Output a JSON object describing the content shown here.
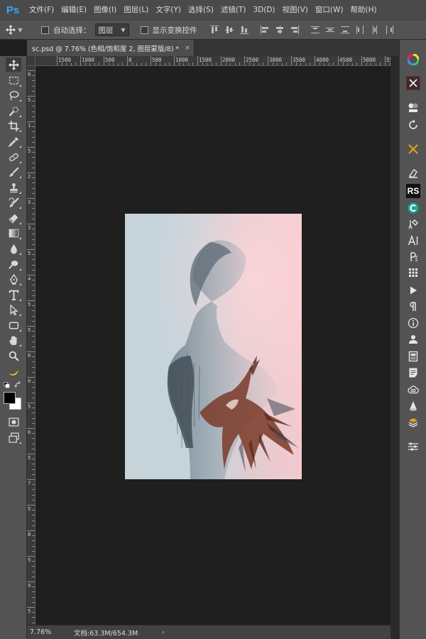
{
  "app": {
    "logo": "Ps"
  },
  "menubar": {
    "items": [
      "文件(F)",
      "编辑(E)",
      "图像(I)",
      "图层(L)",
      "文字(Y)",
      "选择(S)",
      "滤镜(T)",
      "3D(D)",
      "视图(V)",
      "窗口(W)",
      "帮助(H)"
    ]
  },
  "options": {
    "move_icon": "move-icon",
    "auto_select_label": "自动选择：",
    "auto_select_value": "图层",
    "show_transform_label": "显示变换控件"
  },
  "document": {
    "tab_title": "sc.psd @ 7.76% (色相/饱和度 2, 图层蒙版/8) *",
    "close_glyph": "×"
  },
  "rulers": {
    "top_labels": [
      "1500",
      "1000",
      "500",
      "0",
      "500",
      "1000",
      "1500",
      "2000",
      "2500",
      "3000",
      "3500",
      "4000",
      "4500",
      "5000",
      "5500"
    ],
    "left_labels": [
      "0",
      "5",
      "1",
      "5",
      "2",
      "3",
      "3",
      "5",
      "4",
      "5",
      "5",
      "0",
      "0",
      "5",
      "6",
      "5",
      "7",
      "5",
      "8",
      "5",
      "9",
      "5"
    ]
  },
  "colors": {
    "foreground": "#000000",
    "background": "#ffffff",
    "ps_blue": "#31a8ff"
  },
  "right_panel": {
    "icons": [
      "color-wheel-icon",
      "scissors-icon",
      "adjustment-icon",
      "history-icon",
      "brush-cross-icon",
      "eraser-stamp-icon",
      "rs-plugin-icon",
      "c-plugin-icon",
      "tools-icon",
      "character-icon",
      "paragraph-styles-icon",
      "actions-icon",
      "play-icon",
      "paragraph-icon",
      "info-icon",
      "user-icon",
      "book-icon",
      "notes-icon",
      "creative-cloud-icon",
      "cone-icon",
      "layer-stack-icon",
      "properties-icon"
    ],
    "rs_label": "RS"
  },
  "status": {
    "zoom": "7.76%",
    "doc_info": "文档:63.3M/654.3M",
    "arrow": "›"
  }
}
